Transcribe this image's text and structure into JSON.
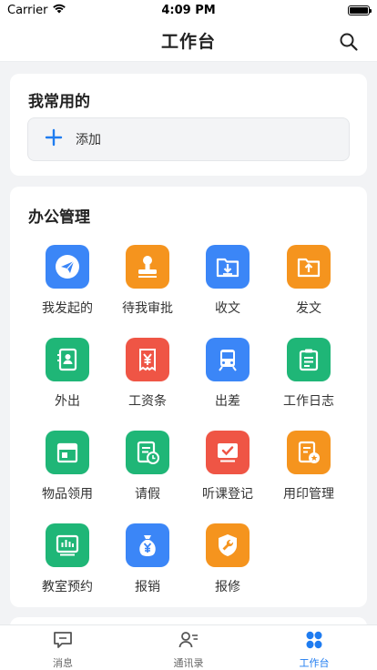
{
  "status": {
    "carrier": "Carrier",
    "time": "4:09 PM",
    "battery_level": 1.0
  },
  "header": {
    "title": "工作台",
    "search_icon": "search-icon"
  },
  "favorites": {
    "title": "我常用的",
    "add_label": "添加",
    "add_icon": "plus-icon"
  },
  "office": {
    "title": "办公管理",
    "items": [
      {
        "label": "我发起的",
        "icon": "paper-plane-icon",
        "color": "#3b86f7"
      },
      {
        "label": "待我审批",
        "icon": "stamp-icon",
        "color": "#f5941e"
      },
      {
        "label": "收文",
        "icon": "folder-download-icon",
        "color": "#3b86f7"
      },
      {
        "label": "发文",
        "icon": "folder-upload-icon",
        "color": "#f5941e"
      },
      {
        "label": "外出",
        "icon": "contact-book-icon",
        "color": "#1fb677"
      },
      {
        "label": "工资条",
        "icon": "yen-receipt-icon",
        "color": "#ef5545"
      },
      {
        "label": "出差",
        "icon": "train-icon",
        "color": "#3b86f7"
      },
      {
        "label": "工作日志",
        "icon": "clipboard-icon",
        "color": "#1fb677"
      },
      {
        "label": "物品领用",
        "icon": "box-icon",
        "color": "#1fb677"
      },
      {
        "label": "请假",
        "icon": "form-clock-icon",
        "color": "#1fb677"
      },
      {
        "label": "听课登记",
        "icon": "monitor-check-icon",
        "color": "#ef5545"
      },
      {
        "label": "用印管理",
        "icon": "seal-document-icon",
        "color": "#f5941e"
      },
      {
        "label": "教室预约",
        "icon": "bar-chart-board-icon",
        "color": "#1fb677"
      },
      {
        "label": "报销",
        "icon": "money-bag-icon",
        "color": "#3b86f7"
      },
      {
        "label": "报修",
        "icon": "wrench-shield-icon",
        "color": "#f5941e"
      }
    ]
  },
  "tabs": [
    {
      "label": "消息",
      "icon": "message-icon",
      "active": false
    },
    {
      "label": "通讯录",
      "icon": "contacts-icon",
      "active": false
    },
    {
      "label": "工作台",
      "icon": "workbench-icon",
      "active": true
    }
  ],
  "colors": {
    "accent": "#1f7cf0",
    "blue": "#3b86f7",
    "orange": "#f5941e",
    "green": "#1fb677",
    "red": "#ef5545"
  }
}
